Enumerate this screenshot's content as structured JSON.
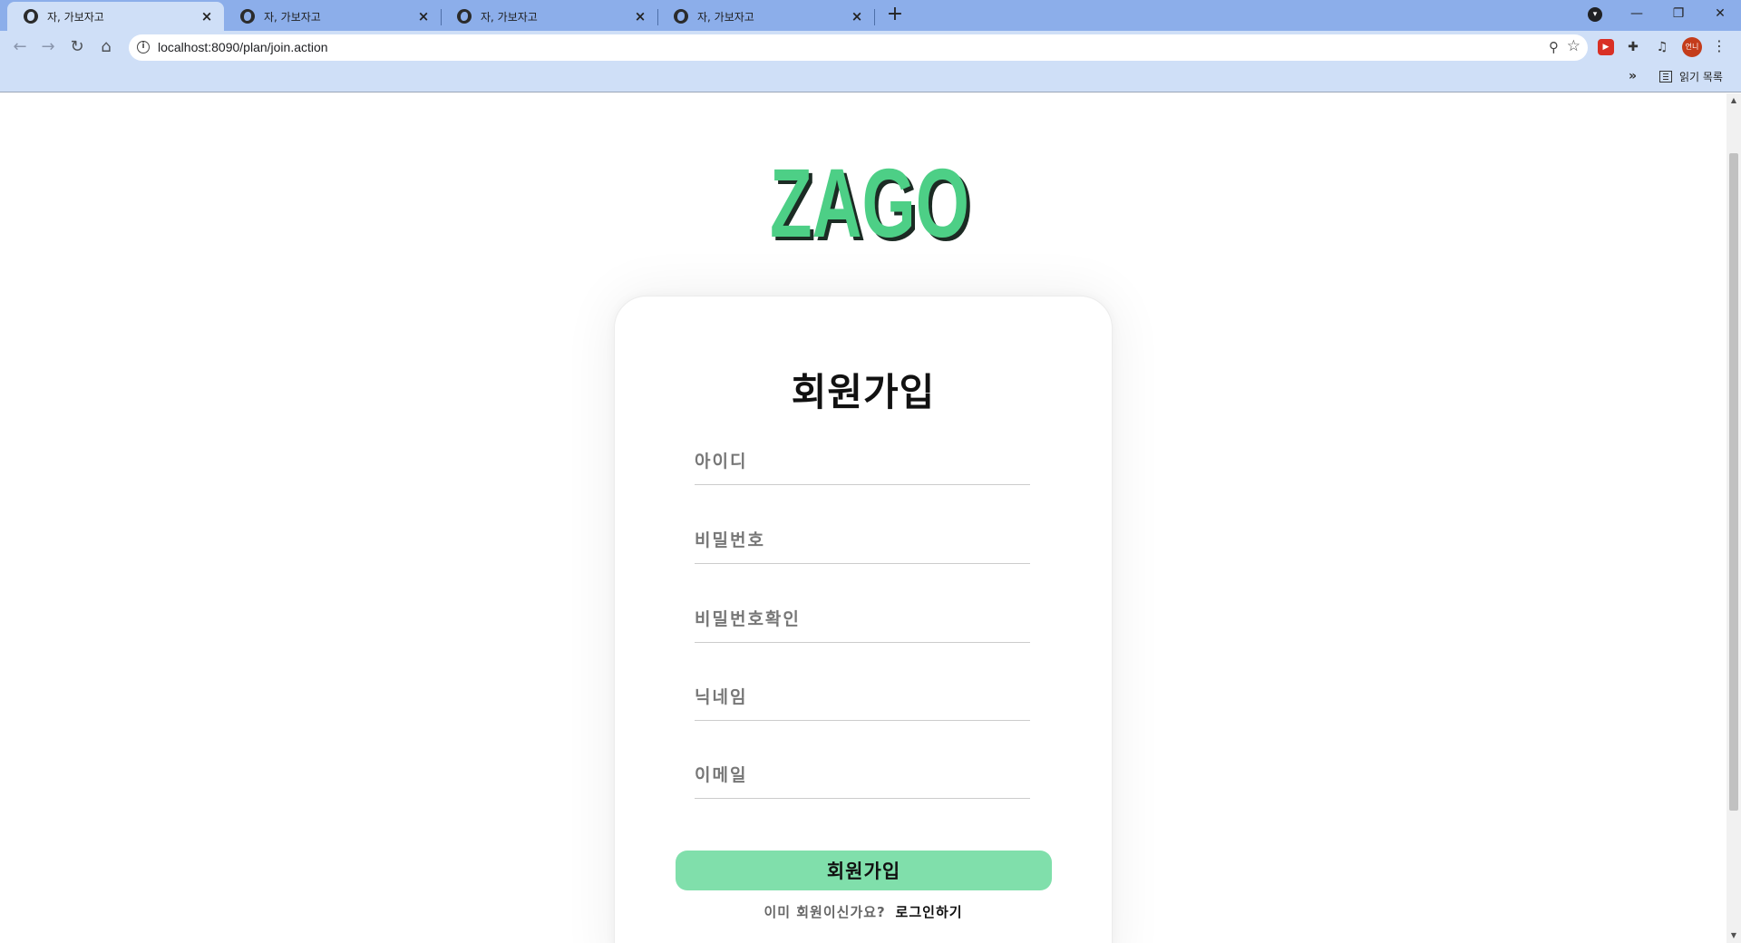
{
  "browser": {
    "tabs": [
      {
        "title": "자, 가보자고",
        "active": true
      },
      {
        "title": "자, 가보자고",
        "active": false
      },
      {
        "title": "자, 가보자고",
        "active": false
      },
      {
        "title": "자, 가보자고",
        "active": false
      }
    ],
    "new_tab": "+",
    "address": "localhost:8090/plan/join.action",
    "profile_label": "언니",
    "window_controls": {
      "minimize": "—",
      "restore": "❐",
      "close": "✕"
    },
    "bookmarks_more": "»",
    "reading_list": "읽기 목록"
  },
  "page": {
    "logo_text": "ZAGO",
    "title": "회원가입",
    "fields": {
      "id_placeholder": "아이디",
      "password_placeholder": "비밀번호",
      "password_confirm_placeholder": "비밀번호확인",
      "nickname_placeholder": "닉네임",
      "email_placeholder": "이메일"
    },
    "submit_label": "회원가입",
    "already_member": "이미 회원이신가요?",
    "login_link": "로그인하기"
  },
  "colors": {
    "brand_green": "#4dcf86",
    "button_green": "#80dfab",
    "tab_strip": "#8caeea",
    "toolbar": "#cfdff7"
  }
}
